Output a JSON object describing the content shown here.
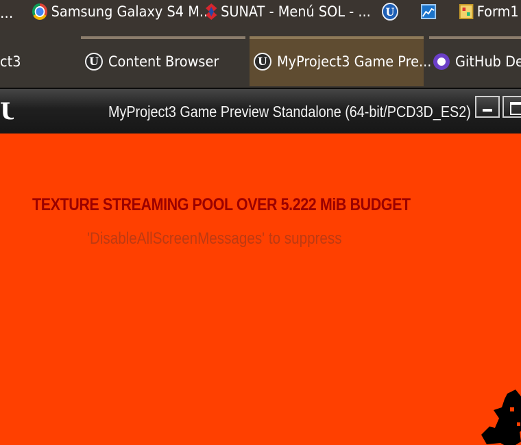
{
  "taskbar_top": {
    "items": [
      {
        "label": "..."
      },
      {
        "label": "Samsung Galaxy S4 M...",
        "icon": "chrome-icon"
      },
      {
        "label": "SUNAT - Menú SOL - ...",
        "icon": "sunat-icon"
      },
      {
        "label": "",
        "icon": "unreal-engine-icon"
      },
      {
        "label": "",
        "icon": "chart-app-icon"
      },
      {
        "label": "Form1",
        "icon": "form-app-icon"
      }
    ]
  },
  "taskbar_second": {
    "tabs": [
      {
        "label": "ct3"
      },
      {
        "label": "Content Browser",
        "icon": "unreal-engine-icon"
      },
      {
        "label": "MyProject3 Game Pre...",
        "icon": "unreal-engine-icon",
        "active": true
      },
      {
        "label": "GitHub Desk",
        "icon": "github-icon"
      }
    ]
  },
  "window": {
    "title": "MyProject3 Game Preview Standalone (64-bit/PCD3D_ES2)",
    "logo": "U"
  },
  "viewport": {
    "background": "#ff4000",
    "warning": "TEXTURE STREAMING POOL OVER 5.222 MiB BUDGET",
    "hint": "'DisableAllScreenMessages' to suppress"
  },
  "colors": {
    "taskbar": "#3a3631",
    "active_tab": "#5f4c31",
    "warning_text": "#9b0000",
    "hint_text": "#bd3a12"
  }
}
